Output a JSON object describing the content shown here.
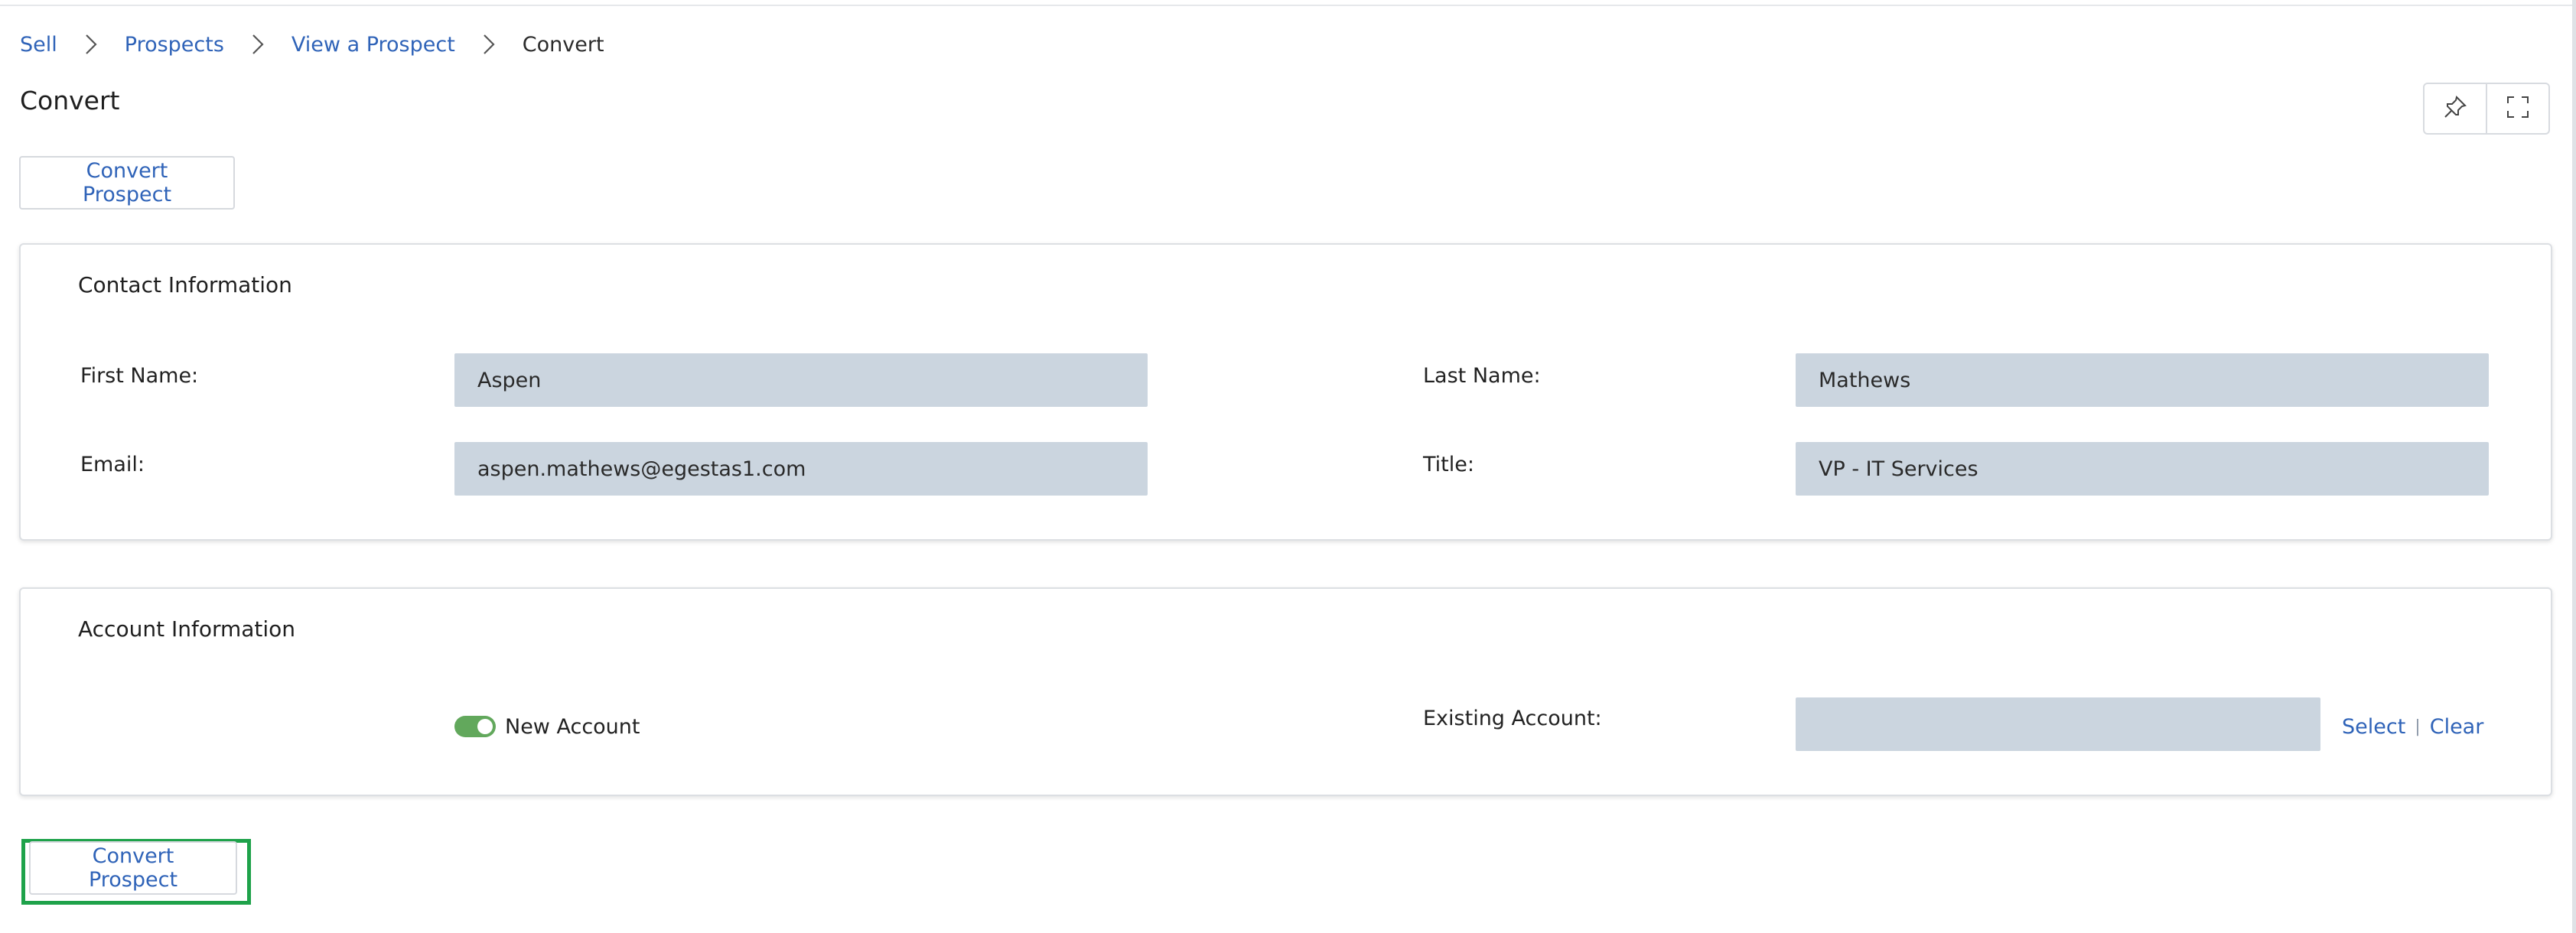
{
  "breadcrumb": {
    "items": [
      "Sell",
      "Prospects",
      "View a Prospect"
    ],
    "current": "Convert"
  },
  "page": {
    "title": "Convert"
  },
  "toolbar": {
    "pin_icon": "pin-icon",
    "fullscreen_icon": "expand-icon"
  },
  "actions": {
    "convert_label": "Convert Prospect"
  },
  "contact": {
    "title": "Contact Information",
    "first_name_label": "First Name:",
    "first_name_value": "Aspen",
    "last_name_label": "Last Name:",
    "last_name_value": "Mathews",
    "email_label": "Email:",
    "email_value": "aspen.mathews@egestas1.com",
    "title_label": "Title:",
    "title_value": "VP - IT Services"
  },
  "account": {
    "title": "Account Information",
    "new_account_label": "New Account",
    "new_account_on": true,
    "existing_label": "Existing Account:",
    "existing_value": "",
    "select_label": "Select",
    "separator": "|",
    "clear_label": "Clear"
  },
  "colors": {
    "link": "#2f63b8",
    "input_bg": "#cbd5df",
    "toggle_on": "#62a85c",
    "highlight": "#1ea24a"
  }
}
